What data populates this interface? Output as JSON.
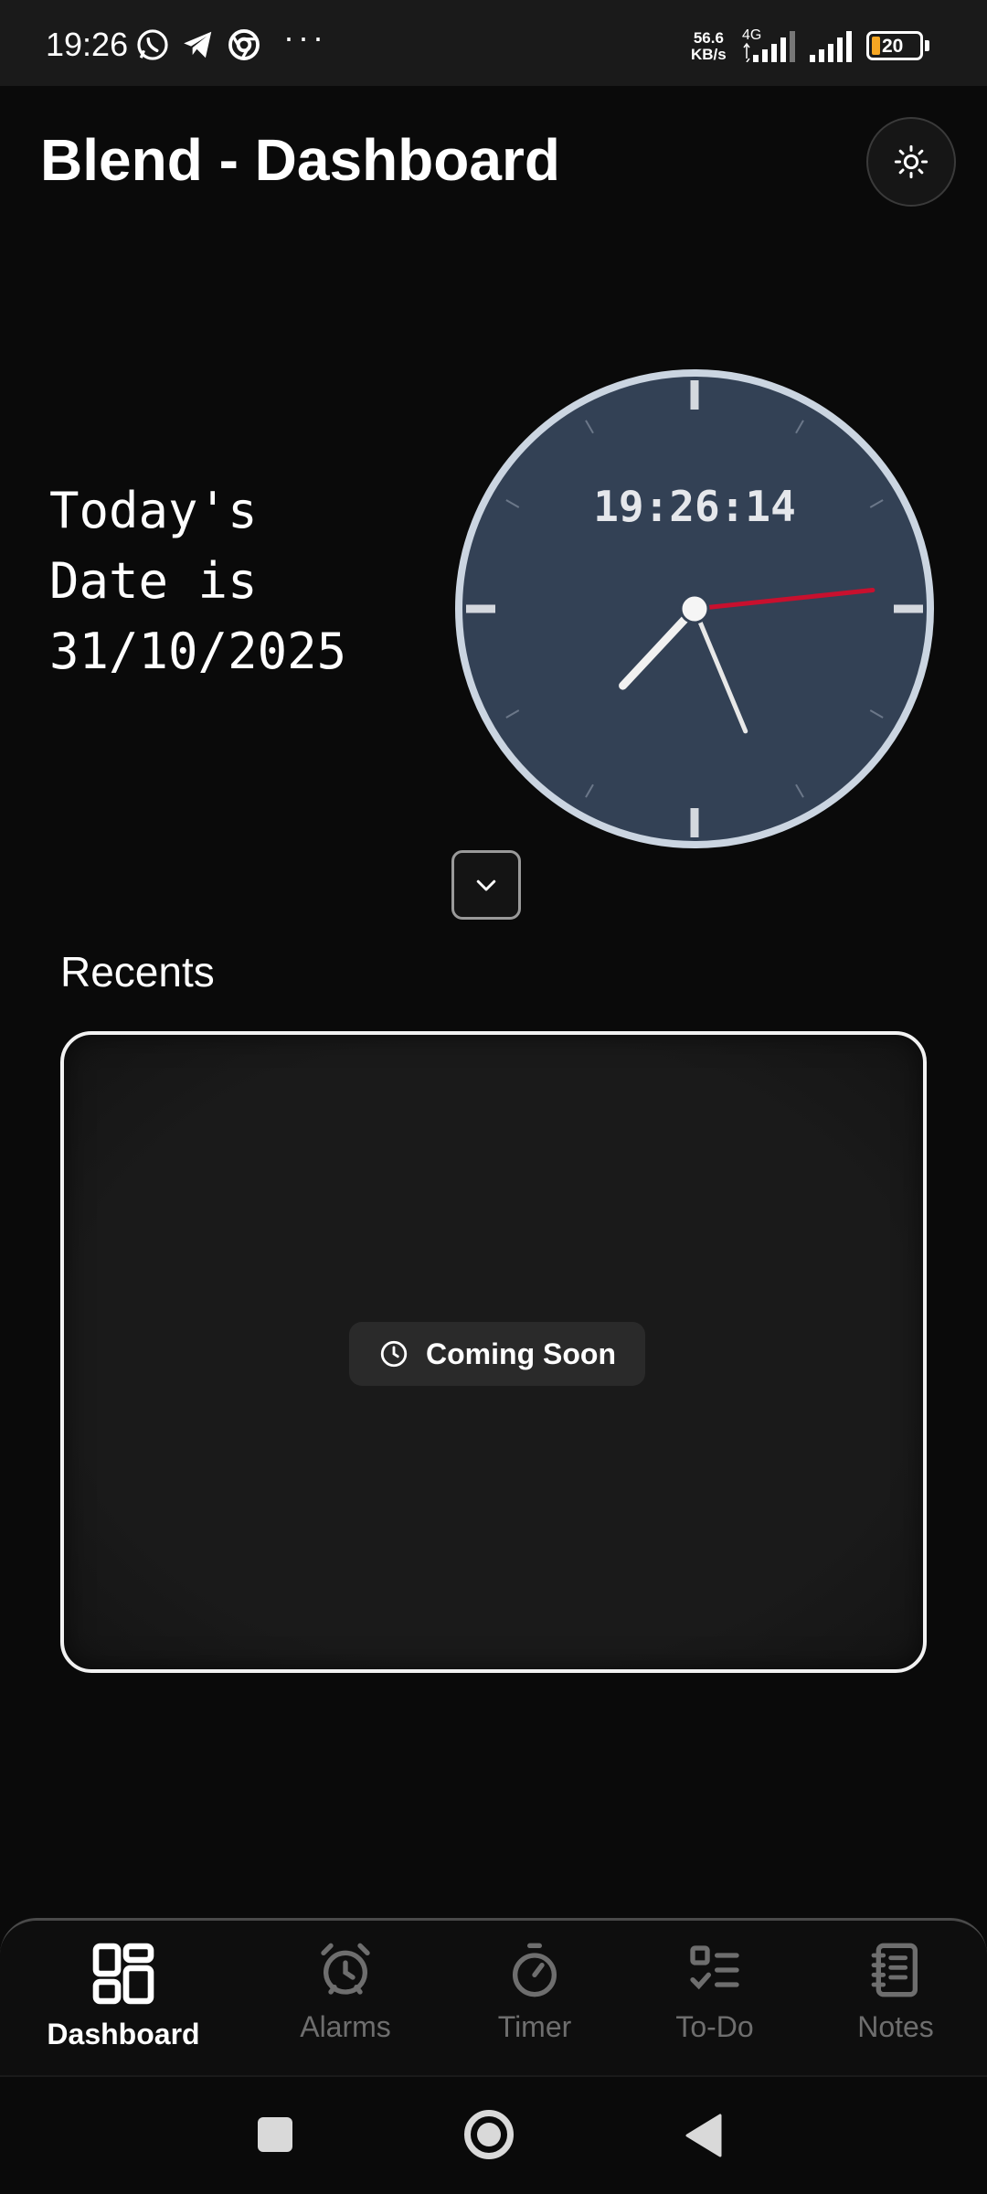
{
  "status_bar": {
    "time": "19:26",
    "net_speed_value": "56.6",
    "net_speed_unit": "KB/s",
    "network_type": "4G",
    "battery": "20",
    "icons": [
      "whatsapp-icon",
      "telegram-icon",
      "chrome-icon",
      "more-icon",
      "signal-icon",
      "signal-icon",
      "battery-icon"
    ]
  },
  "header": {
    "title": "Blend - Dashboard",
    "theme_icon": "sun-icon"
  },
  "date_panel": {
    "line1": "Today's",
    "line2": "Date is",
    "line3": "31/10/2025"
  },
  "clock": {
    "digital_time": "19:26:14",
    "hours": 19,
    "minutes": 26,
    "seconds": 14,
    "face_color": "#334155",
    "rim_color": "#cbd5e1",
    "second_hand_color": "#c8102e"
  },
  "expand_button": {
    "icon": "chevron-down-icon"
  },
  "recents": {
    "title": "Recents",
    "badge_label": "Coming Soon",
    "badge_icon": "clock-icon"
  },
  "bottom_nav": {
    "items": [
      {
        "label": "Dashboard",
        "icon": "dashboard-icon",
        "active": true
      },
      {
        "label": "Alarms",
        "icon": "alarm-icon",
        "active": false
      },
      {
        "label": "Timer",
        "icon": "timer-icon",
        "active": false
      },
      {
        "label": "To-Do",
        "icon": "todo-icon",
        "active": false
      },
      {
        "label": "Notes",
        "icon": "notes-icon",
        "active": false
      }
    ]
  },
  "system_nav": {
    "icons": [
      "recents-square-icon",
      "home-circle-icon",
      "back-triangle-icon"
    ]
  }
}
